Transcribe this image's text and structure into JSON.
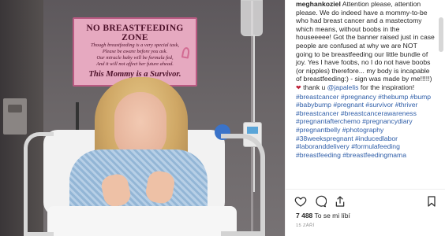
{
  "photo": {
    "banner": {
      "title": "NO BREASTFEEDING ZONE",
      "lines": [
        "Though breastfeeding is a very special task,",
        "Please be aware before you ask.",
        "Our miracle baby will be formula fed,",
        "And it will not affect her future ahead."
      ],
      "big": "This Mommy is a Survivor."
    }
  },
  "post": {
    "username": "meghankoziel",
    "caption_segments": [
      {
        "type": "text",
        "value": " Attention please, attention please. We do indeed have a mommy-to-be who had breast cancer and a mastectomy which means, without boobs in the houseeeee! Got the banner raised just in case people are confused at why we are NOT going to be breastfeeding our little bundle of joy. Yes I have foobs, no I do not have boobs (or nipples) therefore... my body is incapable of breastfeeding:) - sign was made by me!!!!!) "
      },
      {
        "type": "heart",
        "value": "❤"
      },
      {
        "type": "text",
        "value": " thank u "
      },
      {
        "type": "tag",
        "value": "@japalelis"
      },
      {
        "type": "text",
        "value": " for the inspiration! "
      },
      {
        "type": "tag",
        "value": "#breastcancer"
      },
      {
        "type": "text",
        "value": " "
      },
      {
        "type": "tag",
        "value": "#pregnancy"
      },
      {
        "type": "text",
        "value": " "
      },
      {
        "type": "tag",
        "value": "#thebump"
      },
      {
        "type": "text",
        "value": " "
      },
      {
        "type": "tag",
        "value": "#bump"
      },
      {
        "type": "text",
        "value": " "
      },
      {
        "type": "tag",
        "value": "#babybump"
      },
      {
        "type": "text",
        "value": " "
      },
      {
        "type": "tag",
        "value": "#pregnant"
      },
      {
        "type": "text",
        "value": " "
      },
      {
        "type": "tag",
        "value": "#survivor"
      },
      {
        "type": "text",
        "value": " "
      },
      {
        "type": "tag",
        "value": "#thriver"
      },
      {
        "type": "text",
        "value": " "
      },
      {
        "type": "tag",
        "value": "#breastcancer"
      },
      {
        "type": "text",
        "value": " "
      },
      {
        "type": "tag",
        "value": "#breastcancerawareness"
      },
      {
        "type": "text",
        "value": " "
      },
      {
        "type": "tag",
        "value": "#pregnantafterchemo"
      },
      {
        "type": "text",
        "value": " "
      },
      {
        "type": "tag",
        "value": "#pregnancydiary"
      },
      {
        "type": "text",
        "value": " "
      },
      {
        "type": "tag",
        "value": "#pregnantbelly"
      },
      {
        "type": "text",
        "value": " "
      },
      {
        "type": "tag",
        "value": "#photography"
      },
      {
        "type": "text",
        "value": " "
      },
      {
        "type": "tag",
        "value": "#38weekspregnant"
      },
      {
        "type": "text",
        "value": " "
      },
      {
        "type": "tag",
        "value": "#inducedlabor"
      },
      {
        "type": "text",
        "value": " "
      },
      {
        "type": "tag",
        "value": "#laboranddelivery"
      },
      {
        "type": "text",
        "value": " "
      },
      {
        "type": "tag",
        "value": "#formulafeeding"
      },
      {
        "type": "text",
        "value": " "
      },
      {
        "type": "tag",
        "value": "#breastfeeding"
      },
      {
        "type": "text",
        "value": " "
      },
      {
        "type": "tag",
        "value": "#breastfeedingmama"
      }
    ],
    "likes_count": "7 488",
    "likes_suffix": " To se mi líbí",
    "date": "15 ZÁŘÍ",
    "icons": [
      "heart-outline-icon",
      "comment-icon",
      "share-icon",
      "bookmark-icon"
    ]
  },
  "colors": {
    "hashtag": "#2f5ea8",
    "text": "#262626",
    "muted": "#8e8e8e",
    "banner_bg": "#e6a9c0"
  }
}
